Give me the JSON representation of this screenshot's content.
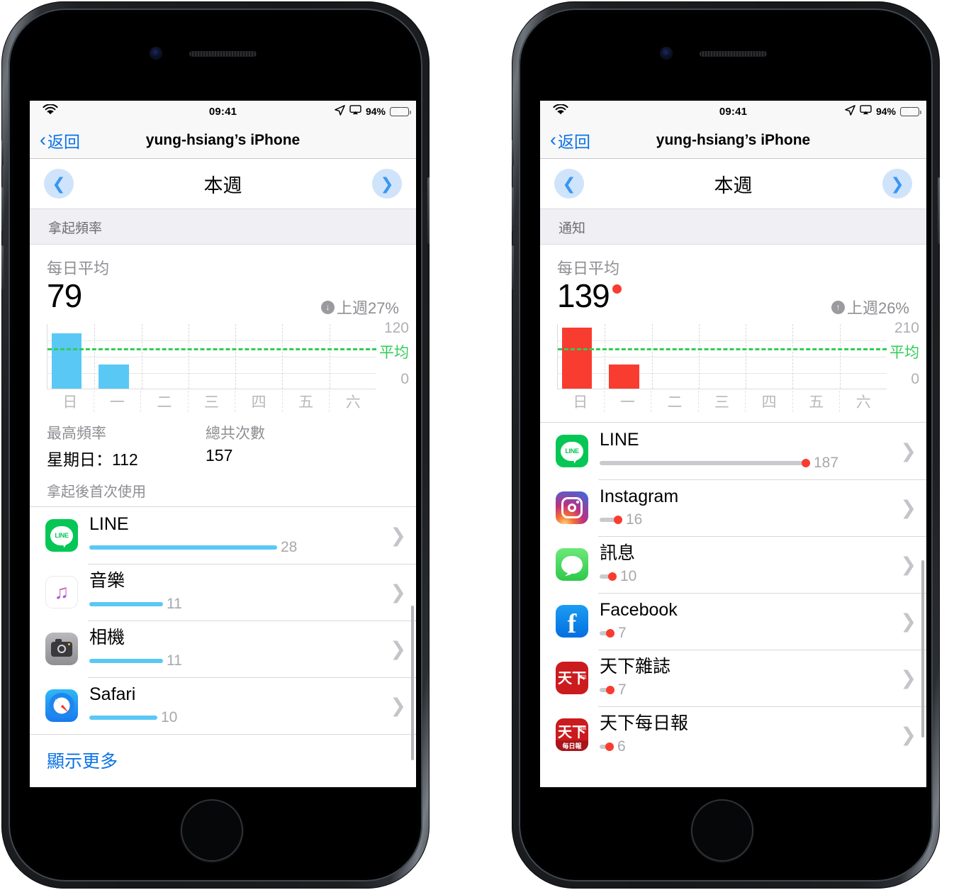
{
  "statusbar": {
    "time": "09:41",
    "battery_pct": "94%",
    "wifi_icon": "wifi-icon",
    "location_icon": "location-arrow-icon",
    "airplay_icon": "airplay-icon",
    "battery_icon": "battery-charging-icon"
  },
  "navbar": {
    "back_label": "返回",
    "back_chevron": "‹",
    "title": "yung-hsiang’s iPhone"
  },
  "weekbar": {
    "title": "本週",
    "prev_icon": "chevron-left-icon",
    "next_icon": "chevron-right-icon"
  },
  "left": {
    "section_header": "拿起頻率",
    "summary": {
      "label": "每日平均",
      "value": "79",
      "compare_direction": "down",
      "compare_arrow": "↓",
      "compare_text": "上週27%"
    },
    "stats": [
      {
        "key": "最高頻率",
        "value": "星期日：112"
      },
      {
        "key": "總共次數",
        "value": "157"
      }
    ],
    "list_label": "拿起後首次使用",
    "apps": [
      {
        "name": "LINE",
        "value": "28",
        "icon": "line-icon",
        "pct": 100
      },
      {
        "name": "音樂",
        "value": "11",
        "icon": "music-icon",
        "pct": 39
      },
      {
        "name": "相機",
        "value": "11",
        "icon": "camera-icon",
        "pct": 39
      },
      {
        "name": "Safari",
        "value": "10",
        "icon": "safari-icon",
        "pct": 36
      }
    ],
    "show_more": "顯示更多",
    "accent": "#5ac8f5"
  },
  "right": {
    "section_header": "通知",
    "summary": {
      "label": "每日平均",
      "value": "139",
      "badge_dot": true,
      "compare_direction": "up",
      "compare_arrow": "↑",
      "compare_text": "上週26%"
    },
    "apps": [
      {
        "name": "LINE",
        "value": "187",
        "icon": "line-icon",
        "pct": 100
      },
      {
        "name": "Instagram",
        "value": "16",
        "icon": "instagram-icon",
        "pct": 8.5
      },
      {
        "name": "訊息",
        "value": "10",
        "icon": "messages-icon",
        "pct": 5.3
      },
      {
        "name": "Facebook",
        "value": "7",
        "icon": "facebook-icon",
        "pct": 3.7
      },
      {
        "name": "天下雜誌",
        "value": "7",
        "icon": "commonwealth-icon",
        "pct": 3.7
      },
      {
        "name": "天下每日報",
        "value": "6",
        "icon": "commonwealth-daily-icon",
        "pct": 3.2
      }
    ],
    "accent": "#f93c30"
  },
  "chart_data": [
    {
      "type": "bar",
      "title": "拿起頻率 — 每日平均 79",
      "categories": [
        "日",
        "一",
        "二",
        "三",
        "四",
        "五",
        "六"
      ],
      "values": [
        112,
        45,
        0,
        0,
        0,
        0,
        0
      ],
      "ylim": [
        0,
        120
      ],
      "yticks": [
        "0",
        "120"
      ],
      "average_line": 79,
      "average_label": "平均",
      "bar_color": "#5ac8f5",
      "average_color": "#33cc58",
      "grid": true,
      "legend": "none",
      "xlabel": "",
      "ylabel": ""
    },
    {
      "type": "bar",
      "title": "通知 — 每日平均 139",
      "categories": [
        "日",
        "一",
        "二",
        "三",
        "四",
        "五",
        "六"
      ],
      "values": [
        197,
        78,
        0,
        0,
        0,
        0,
        0
      ],
      "ylim": [
        0,
        210
      ],
      "yticks": [
        "0",
        "210"
      ],
      "average_line": 139,
      "average_label": "平均",
      "bar_color": "#f93c30",
      "average_color": "#33cc58",
      "grid": true,
      "legend": "none",
      "xlabel": "",
      "ylabel": ""
    }
  ]
}
